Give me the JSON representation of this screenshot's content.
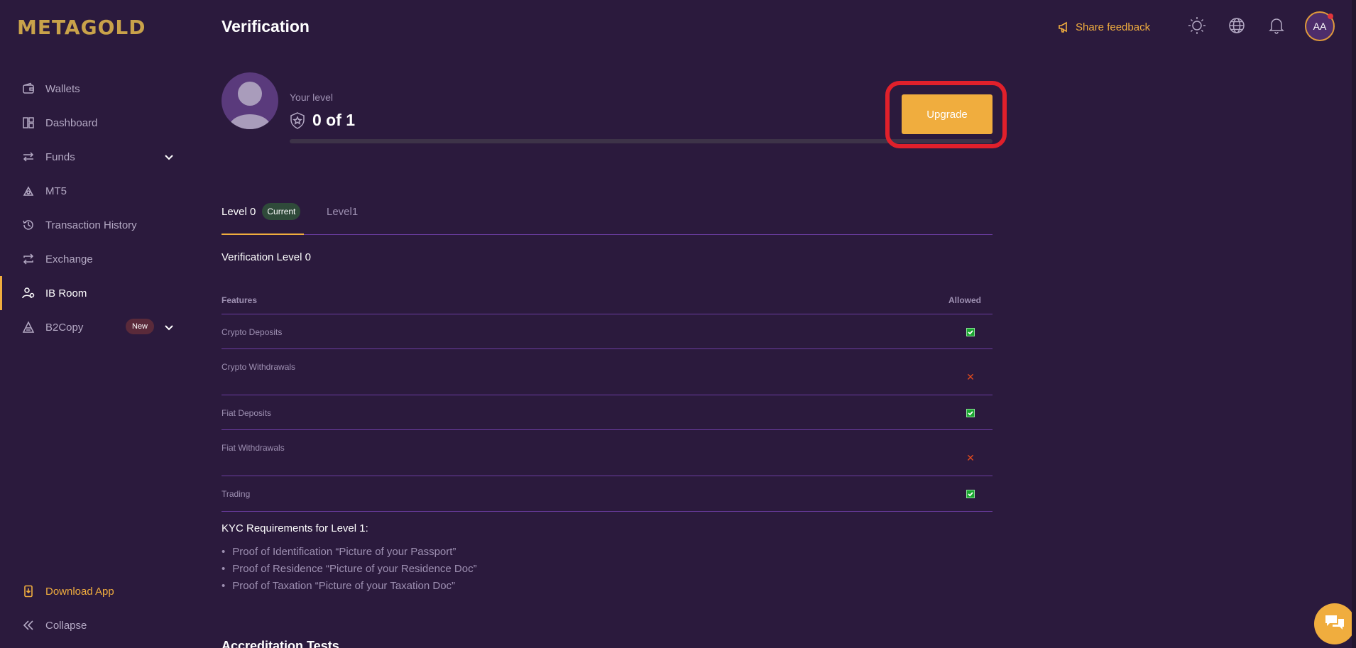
{
  "brand": {
    "logo_text": "METAGOLD"
  },
  "colors": {
    "accent": "#f0ad3e",
    "background": "#2b1a3d",
    "success": "#19a72f",
    "danger": "#e24a1e",
    "highlight": "#e0202b"
  },
  "sidebar": {
    "items": [
      {
        "label": "Wallets",
        "icon": "wallet-icon"
      },
      {
        "label": "Dashboard",
        "icon": "dashboard-icon"
      },
      {
        "label": "Funds",
        "icon": "transfer-icon",
        "has_submenu": true
      },
      {
        "label": "MT5",
        "icon": "mt5-icon"
      },
      {
        "label": "Transaction History",
        "icon": "history-icon"
      },
      {
        "label": "Exchange",
        "icon": "exchange-icon"
      },
      {
        "label": "IB Room",
        "icon": "ib-room-icon",
        "active": true
      },
      {
        "label": "B2Copy",
        "icon": "b2copy-icon",
        "badge": "New",
        "has_submenu": true
      }
    ],
    "download_label": "Download App",
    "collapse_label": "Collapse"
  },
  "header": {
    "title": "Verification",
    "share_feedback": "Share feedback",
    "avatar_initials": "AA"
  },
  "level_card": {
    "your_level_label": "Your level",
    "level_value": "0 of 1",
    "progress_fraction": 0,
    "upgrade_label": "Upgrade"
  },
  "tabs": [
    {
      "label": "Level 0",
      "badge": "Current",
      "active": true
    },
    {
      "label": "Level1",
      "active": false
    }
  ],
  "verification": {
    "section_title": "Verification Level 0",
    "columns": [
      "Features",
      "Allowed"
    ],
    "rows": [
      {
        "feature": "Crypto Deposits",
        "allowed": true
      },
      {
        "feature": "Crypto Withdrawals",
        "allowed": false
      },
      {
        "feature": "Fiat Deposits",
        "allowed": true
      },
      {
        "feature": "Fiat Withdrawals",
        "allowed": false
      },
      {
        "feature": "Trading",
        "allowed": true
      }
    ]
  },
  "kyc": {
    "title": "KYC Requirements for Level 1:",
    "items": [
      "Proof of Identification  “Picture of your Passport”",
      "Proof of Residence  “Picture of your Residence Doc”",
      "Proof of Taxation  “Picture of your Taxation Doc”"
    ]
  },
  "accreditation_title": "Accreditation Tests"
}
